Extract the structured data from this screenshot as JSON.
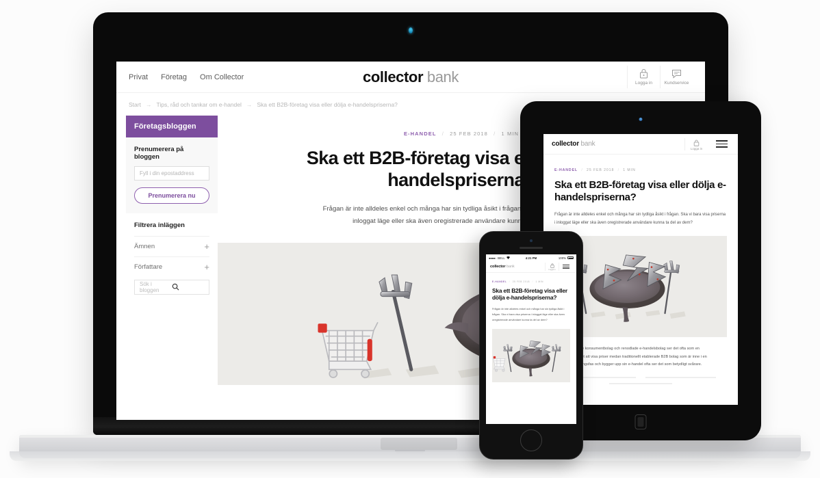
{
  "site": {
    "nav": [
      {
        "label": "Privat"
      },
      {
        "label": "Företag"
      },
      {
        "label": "Om Collector"
      }
    ],
    "brand": {
      "primary": "collector",
      "secondary": "bank"
    },
    "header_icons": [
      {
        "name": "lock-icon",
        "label": "Logga in"
      },
      {
        "name": "chat-icon",
        "label": "Kundservice"
      }
    ],
    "breadcrumb": [
      "Start",
      "Tips, råd och tankar om e-handel",
      "Ska ett B2B-företag visa eller dölja e-handelspriserna?"
    ],
    "breadcrumb_arrow": "→"
  },
  "sidebar": {
    "heading": "Företagsbloggen",
    "subscribe_title": "Prenumerera på bloggen",
    "email_placeholder": "Fyll i din epostaddress",
    "email_value": "",
    "subscribe_button": "Prenumerera nu",
    "filter_title": "Filtrera inläggen",
    "filters": [
      {
        "label": "Ämnen",
        "toggle": "+"
      },
      {
        "label": "Författare",
        "toggle": "+"
      }
    ],
    "search_placeholder": "Sök i bloggen",
    "search_value": ""
  },
  "article": {
    "category": "E-HANDEL",
    "date": "25 FEB 2018",
    "readtime": "1 MIN",
    "separator": "/",
    "headline": "Ska ett B2B-företag visa eller dölja e-handelspriserna?",
    "lead": "Frågan är inte alldeles enkel och många har sin tydliga åsikt i frågan. Ska vi bara visa priserna i inloggat läge eller ska även oregistrerade användare kunna ta del av dem?",
    "body_excerpt": "Renodlade konsumentbolag och renodlade e-handelsbolag ser det ofta som en självklarhet att visa priser medan traditionellt etablerade B2B bolag som är inne i en digitaliseringsfas och bygger upp sin e-handel ofta ser det som betydligt svårare."
  },
  "tablet": {
    "brand": {
      "primary": "collector",
      "secondary": "bank"
    },
    "login_label": "Logga in",
    "menu_icon": "hamburger-icon"
  },
  "phone": {
    "status": {
      "signal": "●●●●○",
      "carrier": "BELL",
      "wifi": "wifi-icon",
      "time": "4:21 PM",
      "battery": "100%"
    },
    "brand": {
      "primary": "collector",
      "secondary": "bank"
    },
    "login_label": "Logga in",
    "headline": "Ska ett B2B-företag visa eller dölja e-handelspriserna?",
    "lead": "Frågan är inte alldeles enkel och många har sin tydliga åsikt i frågan. Ska vi bara visa priserna i inloggat läge eller ska även oregistrerade användare kunna ta del av dem?"
  },
  "colors": {
    "brand_purple": "#7d4e9e",
    "accent_purple": "#8e5fae",
    "hero_bg": "#ecebe8",
    "page_bg": "#fbfbfb",
    "device_black": "#0c0c0c"
  }
}
